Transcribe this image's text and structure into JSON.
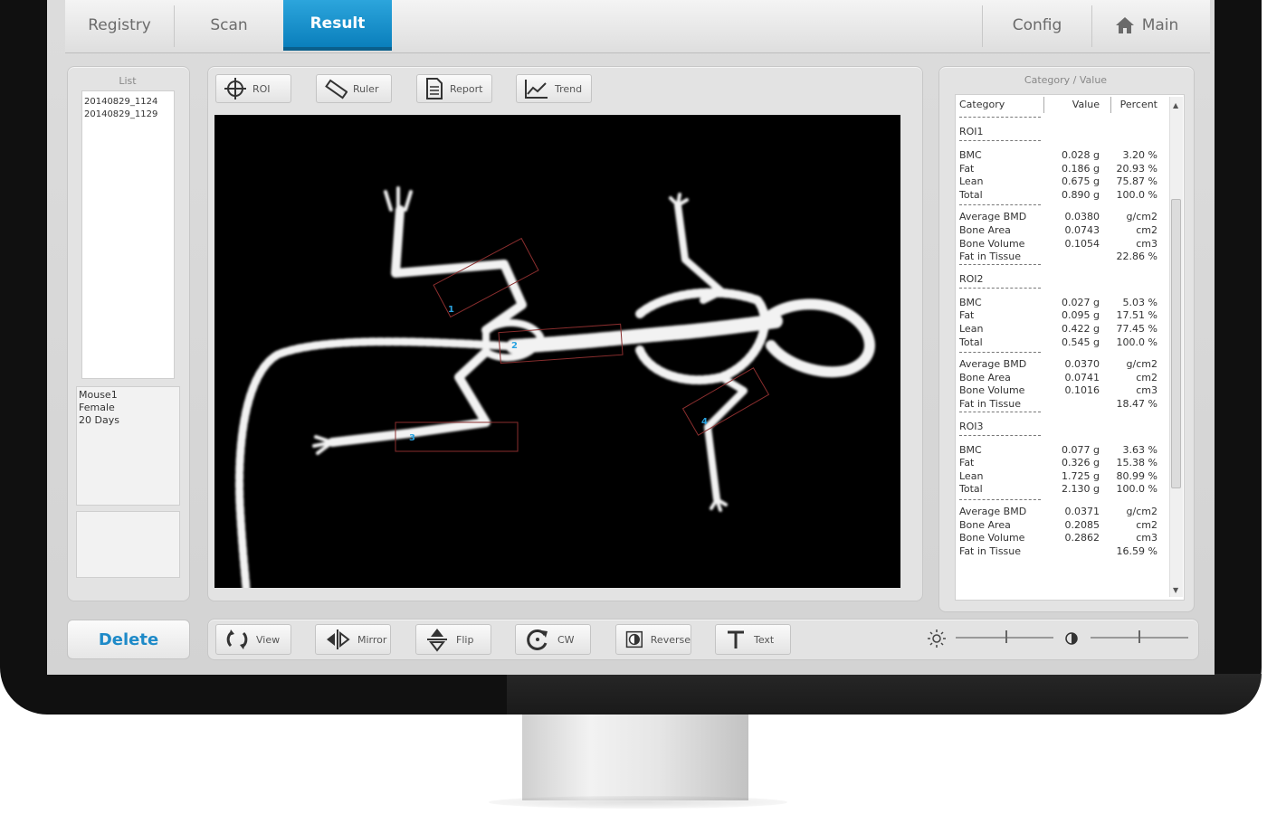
{
  "tabs": {
    "registry": "Registry",
    "scan": "Scan",
    "result": "Result",
    "config": "Config",
    "main": "Main"
  },
  "list_panel": {
    "header": "List",
    "items": [
      "20140829_1124",
      "20140829_1129"
    ],
    "details": [
      "Mouse1",
      "Female",
      "20 Days"
    ]
  },
  "toolbar": {
    "roi": "ROI",
    "ruler": "Ruler",
    "report": "Report",
    "trend": "Trend"
  },
  "results": {
    "header": "Category / Value",
    "col_category": "Category",
    "col_value": "Value",
    "col_percent": "Percent",
    "rows": [
      {
        "type": "title",
        "text": "ROI1"
      },
      {
        "type": "row",
        "c": "BMC",
        "v": "0.028 g",
        "p": "3.20 %"
      },
      {
        "type": "row",
        "c": "Fat",
        "v": "0.186 g",
        "p": "20.93 %"
      },
      {
        "type": "row",
        "c": "Lean",
        "v": "0.675 g",
        "p": "75.87 %"
      },
      {
        "type": "row",
        "c": "Total",
        "v": "0.890 g",
        "p": "100.0 %"
      },
      {
        "type": "row",
        "c": "Average BMD",
        "v": "0.0380",
        "p": "g/cm2"
      },
      {
        "type": "row",
        "c": "Bone Area",
        "v": "0.0743",
        "p": "cm2"
      },
      {
        "type": "row",
        "c": "Bone Volume",
        "v": "0.1054",
        "p": "cm3"
      },
      {
        "type": "row",
        "c": "Fat in Tissue",
        "v": "",
        "p": "22.86 %"
      },
      {
        "type": "title",
        "text": "ROI2"
      },
      {
        "type": "row",
        "c": "BMC",
        "v": "0.027 g",
        "p": "5.03 %"
      },
      {
        "type": "row",
        "c": "Fat",
        "v": "0.095 g",
        "p": "17.51 %"
      },
      {
        "type": "row",
        "c": "Lean",
        "v": "0.422 g",
        "p": "77.45 %"
      },
      {
        "type": "row",
        "c": "Total",
        "v": "0.545 g",
        "p": "100.0 %"
      },
      {
        "type": "row",
        "c": "Average BMD",
        "v": "0.0370",
        "p": "g/cm2"
      },
      {
        "type": "row",
        "c": "Bone Area",
        "v": "0.0741",
        "p": "cm2"
      },
      {
        "type": "row",
        "c": "Bone Volume",
        "v": "0.1016",
        "p": "cm3"
      },
      {
        "type": "row",
        "c": "Fat in Tissue",
        "v": "",
        "p": "18.47 %"
      },
      {
        "type": "title",
        "text": "ROI3"
      },
      {
        "type": "row",
        "c": "BMC",
        "v": "0.077 g",
        "p": "3.63 %"
      },
      {
        "type": "row",
        "c": "Fat",
        "v": "0.326 g",
        "p": "15.38 %"
      },
      {
        "type": "row",
        "c": "Lean",
        "v": "1.725 g",
        "p": "80.99 %"
      },
      {
        "type": "row",
        "c": "Total",
        "v": "2.130 g",
        "p": "100.0 %"
      },
      {
        "type": "row",
        "c": "Average BMD",
        "v": "0.0371",
        "p": "g/cm2"
      },
      {
        "type": "row",
        "c": "Bone Area",
        "v": "0.2085",
        "p": "cm2"
      },
      {
        "type": "row",
        "c": "Bone Volume",
        "v": "0.2862",
        "p": "cm3"
      },
      {
        "type": "row",
        "c": "Fat in Tissue",
        "v": "",
        "p": "16.59 %"
      }
    ]
  },
  "bottom": {
    "delete": "Delete",
    "view": "View",
    "mirror": "Mirror",
    "flip": "Flip",
    "cw": "CW",
    "reverse": "Reverse",
    "text": "Text"
  },
  "roi_markers": [
    "1",
    "2",
    "3",
    "4"
  ],
  "colors": {
    "accent": "#1a8fcf",
    "delete_text": "#1e8ac8",
    "roi_box": "#8a2e2e"
  }
}
